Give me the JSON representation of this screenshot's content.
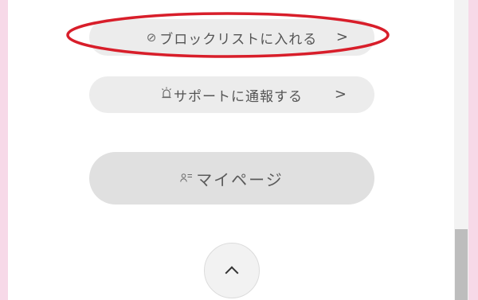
{
  "menu": {
    "block_label": "ブロックリストに入れる",
    "report_label": "サポートに通報する",
    "mypage_label": "マイページ",
    "chevron": ">"
  },
  "icons": {
    "block": "no-entry-icon",
    "report": "siren-icon",
    "mypage": "user-list-icon",
    "scroll_top": "chevron-up-icon"
  },
  "colors": {
    "page_background": "#f7d9e8",
    "annotation_circle": "#d81e2a"
  }
}
